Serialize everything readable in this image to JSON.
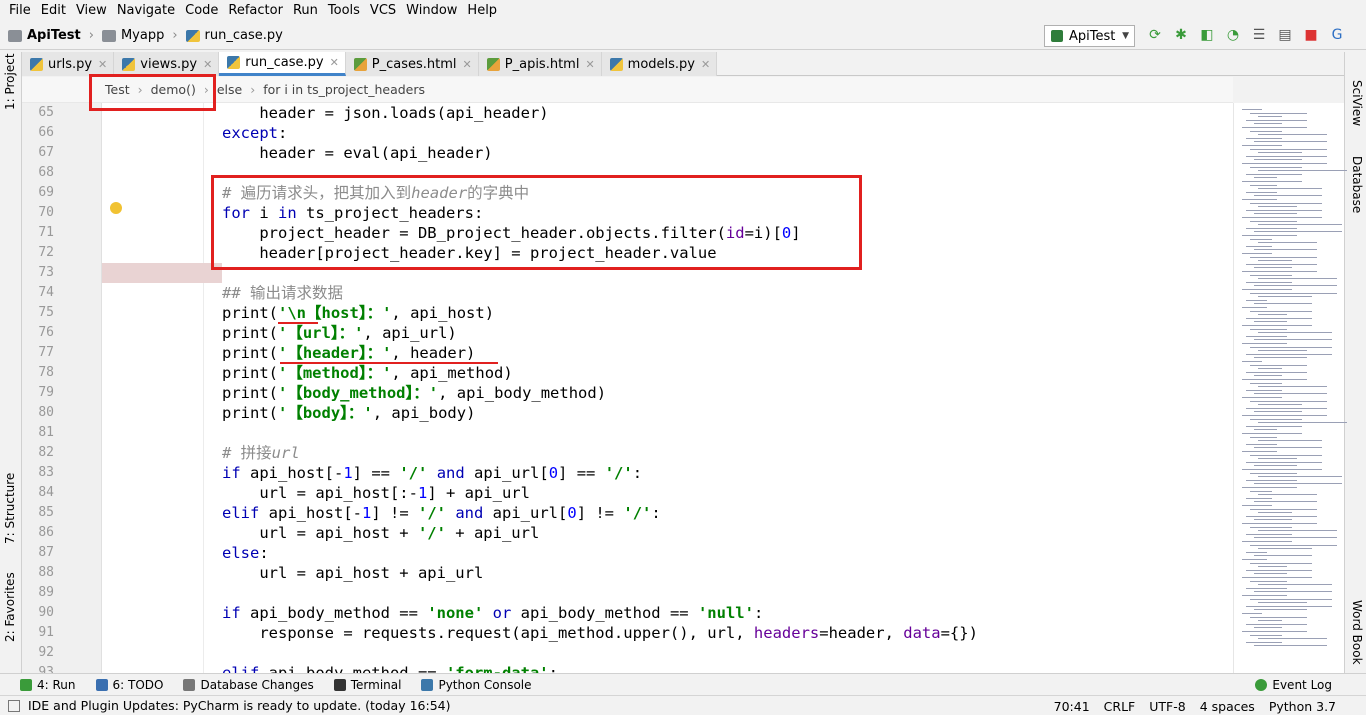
{
  "menu": [
    "File",
    "Edit",
    "View",
    "Navigate",
    "Code",
    "Refactor",
    "Run",
    "Tools",
    "VCS",
    "Window",
    "Help"
  ],
  "breadcrumb": {
    "project": "ApiTest",
    "folder": "Myapp",
    "file": "run_case.py"
  },
  "run_config": {
    "label": "ApiTest"
  },
  "tabs": [
    {
      "label": "urls.py",
      "icon": "python-file-icon"
    },
    {
      "label": "views.py",
      "icon": "python-file-icon"
    },
    {
      "label": "run_case.py",
      "icon": "python-file-icon",
      "active": true
    },
    {
      "label": "P_cases.html",
      "icon": "html-file-icon"
    },
    {
      "label": "P_apis.html",
      "icon": "html-file-icon"
    },
    {
      "label": "models.py",
      "icon": "python-file-icon"
    }
  ],
  "code_breadcrumb": [
    "Test",
    "demo()",
    "else",
    "for i in ts_project_headers"
  ],
  "side_tabs": {
    "project": "1: Project",
    "structure": "7: Structure",
    "favorites": "2: Favorites",
    "sciview": "SciView",
    "database": "Database",
    "wordbook": "Word Book"
  },
  "lines": [
    {
      "n": "65",
      "text": "    header = json.loads(api_header)"
    },
    {
      "n": "66",
      "text": "except:"
    },
    {
      "n": "67",
      "text": "    header = eval(api_header)"
    },
    {
      "n": "68",
      "text": ""
    },
    {
      "n": "69",
      "text": "# 遍历请求头，把其加入到header的字典中"
    },
    {
      "n": "70",
      "text": "for i in ts_project_headers:"
    },
    {
      "n": "71",
      "text": "    project_header = DB_project_header.objects.filter(id=i)[0]"
    },
    {
      "n": "72",
      "text": "    header[project_header.key] = project_header.value"
    },
    {
      "n": "73",
      "text": ""
    },
    {
      "n": "74",
      "text": "## 输出请求数据"
    },
    {
      "n": "75",
      "text": "print('\\n【host】：', api_host)"
    },
    {
      "n": "76",
      "text": "print('【url】：', api_url)"
    },
    {
      "n": "77",
      "text": "print('【header】：', header)"
    },
    {
      "n": "78",
      "text": "print('【method】：', api_method)"
    },
    {
      "n": "79",
      "text": "print('【body_method】：', api_body_method)"
    },
    {
      "n": "80",
      "text": "print('【body】：', api_body)"
    },
    {
      "n": "81",
      "text": ""
    },
    {
      "n": "82",
      "text": "# 拼接url"
    },
    {
      "n": "83",
      "text": "if api_host[-1] == '/' and api_url[0] == '/':"
    },
    {
      "n": "84",
      "text": "    url = api_host[:-1] + api_url"
    },
    {
      "n": "85",
      "text": "elif api_host[-1] != '/' and api_url[0] != '/':"
    },
    {
      "n": "86",
      "text": "    url = api_host + '/' + api_url"
    },
    {
      "n": "87",
      "text": "else:"
    },
    {
      "n": "88",
      "text": "    url = api_host + api_url"
    },
    {
      "n": "89",
      "text": ""
    },
    {
      "n": "90",
      "text": "if api_body_method == 'none' or api_body_method == 'null':"
    },
    {
      "n": "91",
      "text": "    response = requests.request(api_method.upper(), url, headers=header, data={})"
    },
    {
      "n": "92",
      "text": ""
    },
    {
      "n": "93",
      "text": "elif api_body_method == 'form-data':"
    }
  ],
  "tool_windows": [
    {
      "label": "4: Run",
      "icon": "run-icon"
    },
    {
      "label": "6: TODO",
      "icon": "todo-icon"
    },
    {
      "label": "Database Changes",
      "icon": "database-changes-icon"
    },
    {
      "label": "Terminal",
      "icon": "terminal-icon"
    },
    {
      "label": "Python Console",
      "icon": "python-console-icon"
    }
  ],
  "event_log": "Event Log",
  "status": {
    "message": "IDE and Plugin Updates: PyCharm is ready to update. (today 16:54)",
    "position": "70:41",
    "line_sep": "CRLF",
    "encoding": "UTF-8",
    "indent": "4 spaces",
    "interpreter": "Python 3.7"
  },
  "colors": {
    "accent": "#4083c9",
    "annotation": "#e1201f",
    "keyword": "#0000b3",
    "string": "#008000"
  }
}
